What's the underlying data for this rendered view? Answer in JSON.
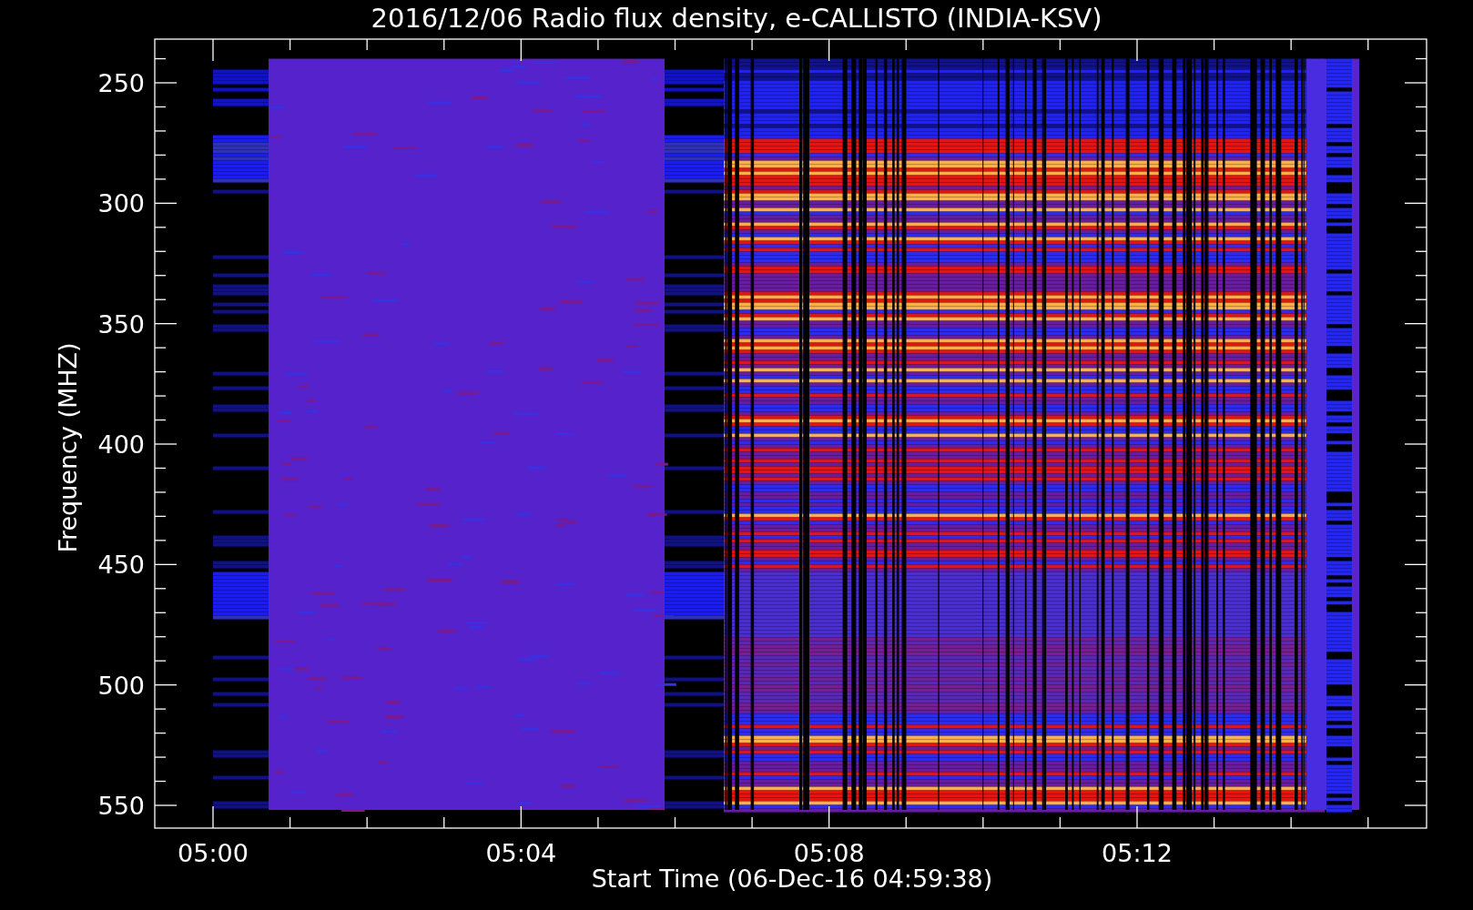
{
  "title": "2016/12/06  Radio flux density, e-CALLISTO (INDIA-KSV)",
  "y_axis": {
    "label": "Frequency (MHZ)",
    "ticks": [
      "250",
      "300",
      "350",
      "400",
      "450",
      "500",
      "550"
    ]
  },
  "x_axis": {
    "label": "Start Time (06-Dec-16 04:59:38)",
    "ticks": [
      "05:00",
      "05:04",
      "05:08",
      "05:12"
    ]
  }
}
